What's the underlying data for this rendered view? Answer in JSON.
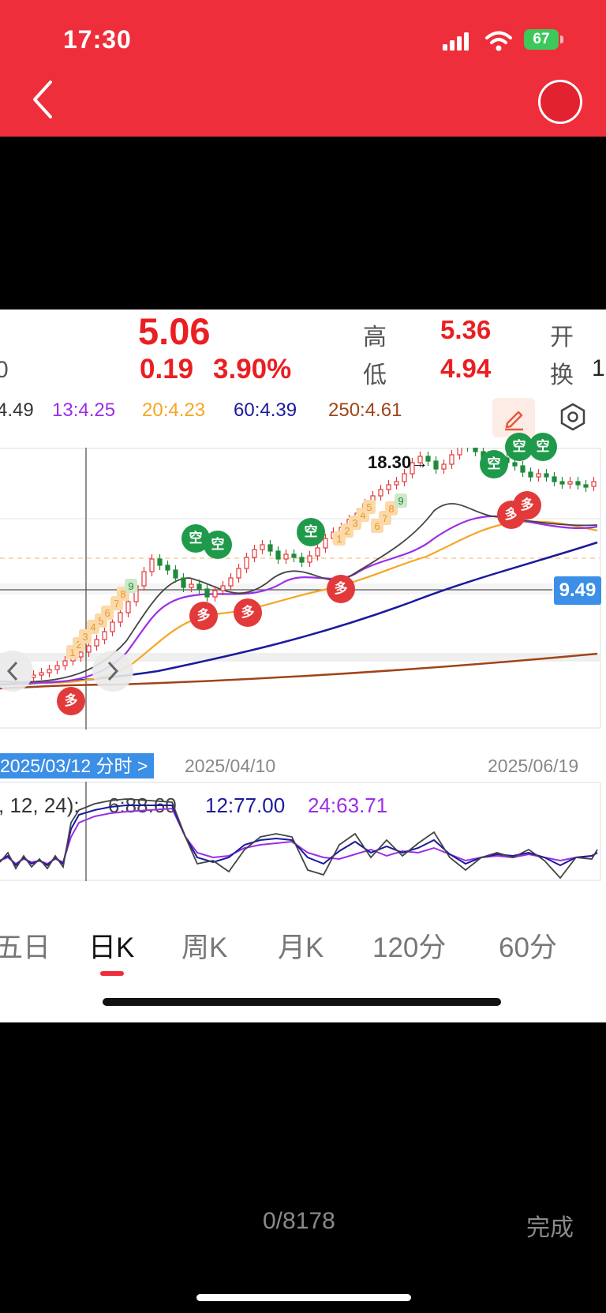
{
  "status": {
    "time": "17:30",
    "battery": "67"
  },
  "quote": {
    "price": "5.06",
    "change": "0.19",
    "change_pct": "3.90%",
    "left_partial": "0",
    "high_label": "高",
    "high": "5.36",
    "low_label": "低",
    "low": "4.94",
    "open_label": "开",
    "turnover_label": "换",
    "turnover_partial": "1"
  },
  "ma": {
    "ma_partial": "4.49",
    "ma13": "13:4.25",
    "ma20": "20:4.23",
    "ma60": "60:4.39",
    "ma250": "250:4.61",
    "colors": {
      "ma13": "#9b2ee6",
      "ma20": "#f5a623",
      "ma60": "#1a1a9e",
      "ma250": "#a0441a"
    }
  },
  "chart": {
    "high_marker": "18.30→",
    "crosshair_value": "9.49",
    "date_badge": "2025/03/12 分时 >",
    "date_mid": "2025/04/10",
    "date_end": "2025/06/19",
    "signal_short": "空",
    "signal_long": "多",
    "td_counts": [
      "1",
      "2",
      "3",
      "4",
      "5",
      "6",
      "7",
      "8",
      "9"
    ]
  },
  "indicator": {
    "params_partial": ", 12, 24):",
    "v6": "6:88.60",
    "v12": "12:77.00",
    "v24": "24:63.71"
  },
  "periods": {
    "items": [
      "五日",
      "日K",
      "周K",
      "月K",
      "120分",
      "60分"
    ],
    "active_index": 1
  },
  "footer": {
    "counter": "0/8178",
    "done": "完成"
  }
}
